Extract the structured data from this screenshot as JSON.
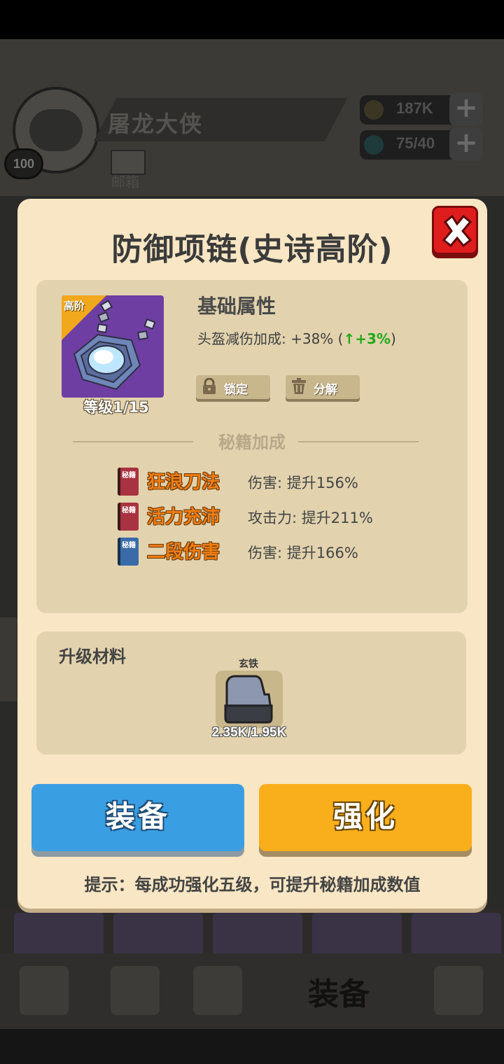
{
  "header": {
    "player_name": "屠龙大侠",
    "player_level": "100",
    "mail_label": "邮箱",
    "resources": [
      {
        "icon": "coin-icon",
        "value": "187K"
      },
      {
        "icon": "energy-icon",
        "value": "75/40"
      }
    ]
  },
  "bottom_nav": {
    "equip_label": "装备"
  },
  "modal": {
    "title": "防御项链(史诗高阶)",
    "item": {
      "badge": "高阶",
      "level_text": "等级1/15"
    },
    "base_attr": {
      "heading": "基础属性",
      "line_prefix": "头盔减伤加成: +38% (",
      "bonus": "+3%",
      "line_suffix": ")"
    },
    "actions": {
      "lock_label": "锁定",
      "disassemble_label": "分解"
    },
    "secret_bonus": {
      "heading": "秘籍加成",
      "book_text": "秘籍",
      "skills": [
        {
          "name": "狂浪刀法",
          "effect": "伤害: 提升156%",
          "book_color": "#a8323f"
        },
        {
          "name": "活力充沛",
          "effect": "攻击力: 提升211%",
          "book_color": "#a8323f"
        },
        {
          "name": "二段伤害",
          "effect": "伤害: 提升166%",
          "book_color": "#3a6aa8"
        }
      ]
    },
    "materials": {
      "heading": "升级材料",
      "items": [
        {
          "name": "玄铁",
          "count": "2.35K/1.95K"
        }
      ]
    },
    "buttons": {
      "equip_label": "装备",
      "enhance_label": "强化"
    },
    "tip": "提示：每成功强化五级，可提升秘籍加成数值"
  },
  "colors": {
    "modal_bg": "#f8e6c4",
    "panel_bg": "#e2d3ae",
    "equip_button": "#3a9ee3",
    "enhance_button": "#f9ae1b",
    "close_button": "#e01d1d",
    "bonus_green": "#22a81a",
    "skill_orange": "#f07d14"
  }
}
